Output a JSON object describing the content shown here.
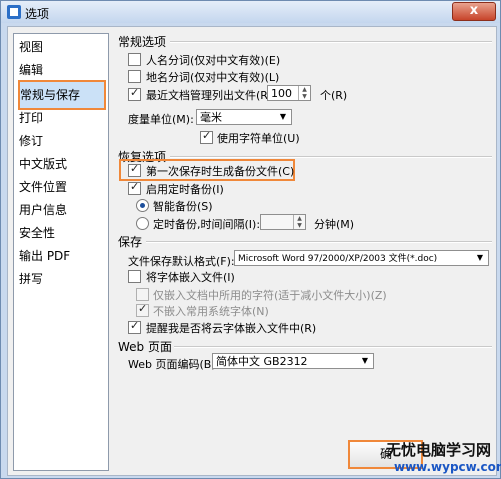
{
  "window": {
    "title": "选项",
    "close_symbol": "x"
  },
  "sidebar": {
    "items": [
      "视图",
      "编辑",
      "常规与保存",
      "打印",
      "修订",
      "中文版式",
      "文件位置",
      "用户信息",
      "安全性",
      "输出 PDF",
      "拼写"
    ]
  },
  "general": {
    "group_title": "常规选项",
    "cb_person_names": "人名分词(仅对中文有效)(E)",
    "cb_place_names": "地名分词(仅对中文有效)(L)",
    "cb_recent_list": "最近文档管理列出文件(R):",
    "recent_count": "100",
    "recent_unit": "个(R)",
    "unit_label": "度量单位(M):",
    "unit_value": "毫米",
    "cb_char_unit": "使用字符单位(U)"
  },
  "recovery": {
    "group_title": "恢复选项",
    "cb_first_backup": "第一次保存时生成备份文件(C)",
    "cb_timed_backup": "启用定时备份(I)",
    "radio_smart": "智能备份(S)",
    "radio_timed": "定时备份,时间间隔(I):",
    "minutes_label": "分钟(M)"
  },
  "save": {
    "group_title": "保存",
    "format_label": "文件保存默认格式(F):",
    "format_value": "Microsoft Word 97/2000/XP/2003 文件(*.doc)",
    "cb_embed_fonts": "将字体嵌入文件(I)",
    "cb_embed_used": "仅嵌入文档中所用的字符(适于减小文件大小)(Z)",
    "cb_no_common": "不嵌入常用系统字体(N)",
    "cb_remind_cloud": "提醒我是否将云字体嵌入文件中(R)"
  },
  "web": {
    "group_title": "Web 页面",
    "encoding_label": "Web 页面编码(B):",
    "encoding_value": "简体中文 GB2312"
  },
  "footer": {
    "ok_label": "确"
  },
  "watermark": {
    "line1": "无忧电脑学习网",
    "line2": "www.wypcw.com"
  }
}
